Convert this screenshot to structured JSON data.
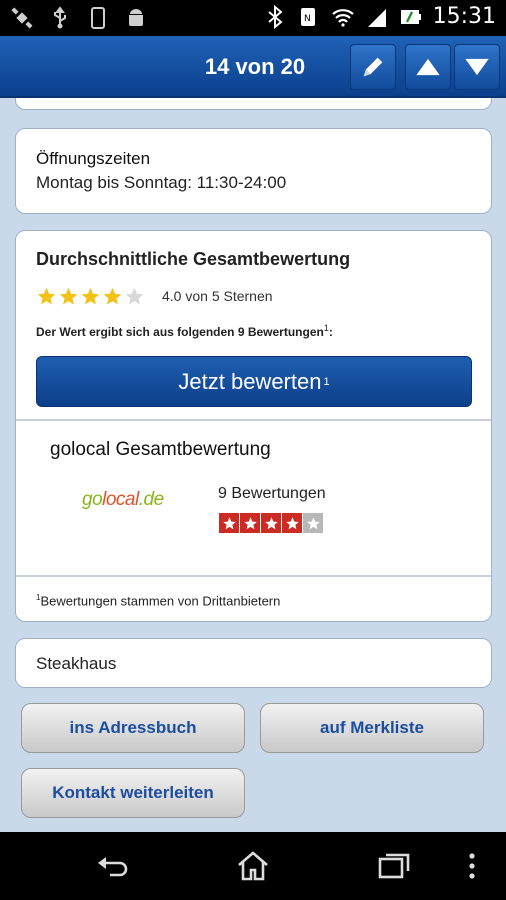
{
  "status_bar": {
    "time": "15:31"
  },
  "action_bar": {
    "title": "14 von 20"
  },
  "hours": {
    "title": "Öffnungszeiten",
    "text": "Montag bis Sonntag: 11:30-24:00"
  },
  "rating": {
    "title": "Durchschnittliche Gesamtbewertung",
    "stars_value": 4.0,
    "stars_max": 5,
    "stars_text": "4.0 von 5 Sternen",
    "note": "Der Wert ergibt sich aus folgenden 9 Bewertungen",
    "note_sup": "1",
    "note_suffix": ":",
    "button_label": "Jetzt bewerten",
    "button_sup": "1"
  },
  "golocal": {
    "title": "golocal Gesamtbewertung",
    "logo_go": "go",
    "logo_local": "local",
    "logo_de": ".de",
    "review_count": "9 Bewertungen",
    "stars_value": 4,
    "stars_max": 5
  },
  "footnote": {
    "sup": "1",
    "text": "Bewertungen stammen von Drittanbietern"
  },
  "category": "Steakhaus",
  "buttons": {
    "address_book": "ins Adressbuch",
    "watchlist": "auf Merkliste",
    "forward_contact": "Kontakt weiterleiten"
  },
  "colors": {
    "accent": "#0d3f8a",
    "star_gold": "#f2c218",
    "star_red": "#cc2b24",
    "background": "#c9d9ea"
  }
}
